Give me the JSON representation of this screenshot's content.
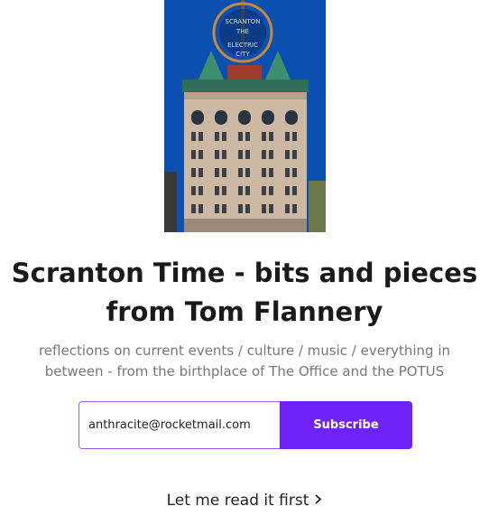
{
  "cover": {
    "sign_text_top": "SCRANTON",
    "sign_text_middle": "THE",
    "sign_text_bottom": "ELECTRIC",
    "sign_text_last": "CITY"
  },
  "publication": {
    "title": "Scranton Time - bits and pieces from Tom Flannery",
    "subtitle": "reflections on current events / culture / music / everything in between - from the birthplace of The Office and the POTUS"
  },
  "subscribe_form": {
    "email_value": "anthracite@rocketmail.com",
    "button_label": "Subscribe"
  },
  "read_first": {
    "label": "Let me read it first",
    "icon": "chevron-right-icon"
  },
  "colors": {
    "accent": "#6f22f7",
    "sky": "#0b4fb0"
  }
}
